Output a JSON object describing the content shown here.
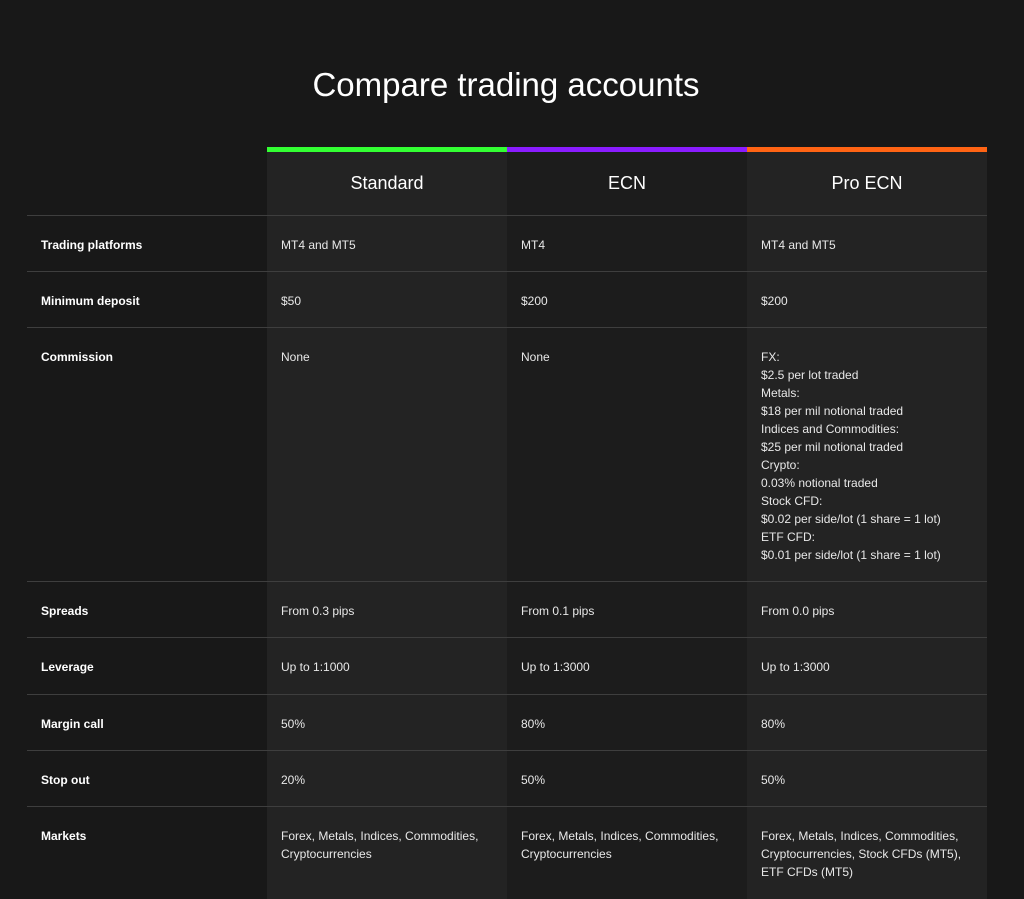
{
  "page": {
    "title": "Compare trading accounts"
  },
  "columns": [
    {
      "name": "Standard",
      "accent": "#33ff33"
    },
    {
      "name": "ECN",
      "accent": "#8a1cff"
    },
    {
      "name": "Pro ECN",
      "accent": "#ff6414"
    }
  ],
  "rows": [
    {
      "label": "Trading platforms",
      "values": [
        [
          "MT4 and MT5"
        ],
        [
          "MT4"
        ],
        [
          "MT4 and MT5"
        ]
      ]
    },
    {
      "label": "Minimum deposit",
      "values": [
        [
          "$50"
        ],
        [
          "$200"
        ],
        [
          "$200"
        ]
      ]
    },
    {
      "label": "Commission",
      "values": [
        [
          "None"
        ],
        [
          "None"
        ],
        [
          "FX:",
          "$2.5 per lot traded",
          "Metals:",
          "$18 per mil notional traded",
          "Indices and Commodities:",
          "$25 per mil notional traded",
          "Crypto:",
          "0.03% notional traded",
          "Stock CFD:",
          "$0.02 per side/lot (1 share = 1 lot)",
          "ETF CFD:",
          "$0.01 per side/lot (1 share = 1 lot)"
        ]
      ]
    },
    {
      "label": "Spreads",
      "values": [
        [
          "From 0.3 pips"
        ],
        [
          "From 0.1 pips"
        ],
        [
          "From 0.0 pips"
        ]
      ]
    },
    {
      "label": "Leverage",
      "values": [
        [
          "Up to 1:1000"
        ],
        [
          "Up to 1:3000"
        ],
        [
          "Up to 1:3000"
        ]
      ]
    },
    {
      "label": "Margin call",
      "values": [
        [
          "50%"
        ],
        [
          "80%"
        ],
        [
          "80%"
        ]
      ]
    },
    {
      "label": "Stop out",
      "values": [
        [
          "20%"
        ],
        [
          "50%"
        ],
        [
          "50%"
        ]
      ]
    },
    {
      "label": "Markets",
      "values": [
        [
          "Forex, Metals, Indices, Commodities,",
          "Cryptocurrencies"
        ],
        [
          "Forex, Metals, Indices, Commodities,",
          "Cryptocurrencies"
        ],
        [
          "Forex, Metals, Indices, Commodities,",
          "Cryptocurrencies, Stock CFDs (MT5),",
          "ETF CFDs (MT5)"
        ]
      ]
    }
  ]
}
